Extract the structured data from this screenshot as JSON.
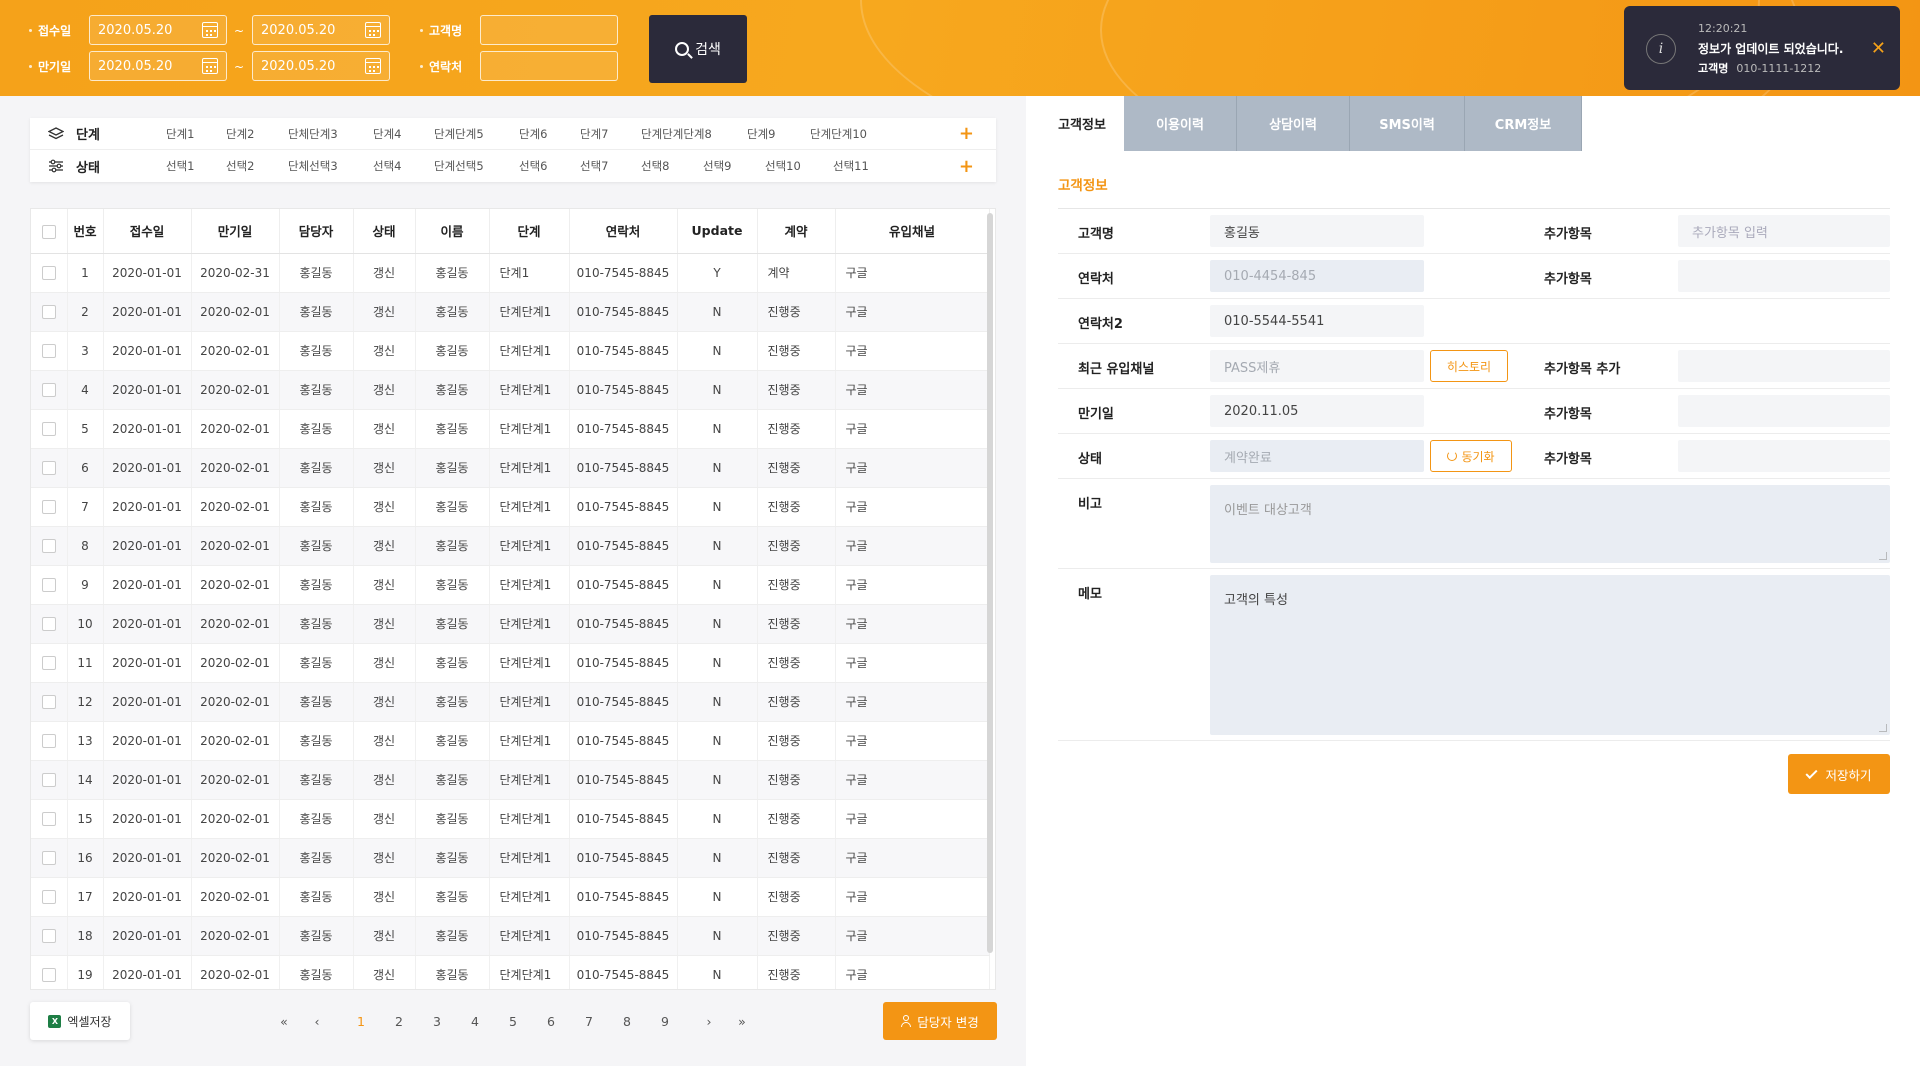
{
  "header": {
    "receipt_label": "접수일",
    "receipt_from": "2020.05.20",
    "receipt_to": "2020.05.20",
    "expiry_label": "만기일",
    "expiry_from": "2020.05.20",
    "expiry_to": "2020.05.20",
    "tilde": "~",
    "customer_label": "고객명",
    "contact_label": "연락처",
    "search_label": "검색"
  },
  "toast": {
    "icon": "i",
    "time": "12:20:21",
    "message": "정보가 업데이트 되었습니다.",
    "sub_label": "고객명",
    "sub_value": "010-1111-1212",
    "close": "✕"
  },
  "filter": {
    "stage_title": "단계",
    "stage_items": [
      "단계1",
      "단계2",
      "단체단계3",
      "단계4",
      "단계단계5",
      "단계6",
      "단계7",
      "단계단계단계8",
      "단계9",
      "단계단계10"
    ],
    "state_title": "상태",
    "state_items": [
      "선택1",
      "선택2",
      "단체선택3",
      "선택4",
      "단계선택5",
      "선택6",
      "선택7",
      "선택8",
      "선택9",
      "선택10",
      "선택11"
    ],
    "plus": "+"
  },
  "table": {
    "headers": [
      "번호",
      "접수일",
      "만기일",
      "담당자",
      "상태",
      "이름",
      "단계",
      "연락처",
      "Update",
      "계약",
      "유입채널"
    ],
    "rows": [
      [
        "1",
        "2020-01-01",
        "2020-02-31",
        "홍길동",
        "갱신",
        "홍길동",
        "단계1",
        "010-7545-8845",
        "Y",
        "계약",
        "구글"
      ],
      [
        "2",
        "2020-01-01",
        "2020-02-01",
        "홍길동",
        "갱신",
        "홍길동",
        "단계단계1",
        "010-7545-8845",
        "N",
        "진행중",
        "구글"
      ],
      [
        "3",
        "2020-01-01",
        "2020-02-01",
        "홍길동",
        "갱신",
        "홍길동",
        "단계단계1",
        "010-7545-8845",
        "N",
        "진행중",
        "구글"
      ],
      [
        "4",
        "2020-01-01",
        "2020-02-01",
        "홍길동",
        "갱신",
        "홍길동",
        "단계단계1",
        "010-7545-8845",
        "N",
        "진행중",
        "구글"
      ],
      [
        "5",
        "2020-01-01",
        "2020-02-01",
        "홍길동",
        "갱신",
        "홍길동",
        "단계단계1",
        "010-7545-8845",
        "N",
        "진행중",
        "구글"
      ],
      [
        "6",
        "2020-01-01",
        "2020-02-01",
        "홍길동",
        "갱신",
        "홍길동",
        "단계단계1",
        "010-7545-8845",
        "N",
        "진행중",
        "구글"
      ],
      [
        "7",
        "2020-01-01",
        "2020-02-01",
        "홍길동",
        "갱신",
        "홍길동",
        "단계단계1",
        "010-7545-8845",
        "N",
        "진행중",
        "구글"
      ],
      [
        "8",
        "2020-01-01",
        "2020-02-01",
        "홍길동",
        "갱신",
        "홍길동",
        "단계단계1",
        "010-7545-8845",
        "N",
        "진행중",
        "구글"
      ],
      [
        "9",
        "2020-01-01",
        "2020-02-01",
        "홍길동",
        "갱신",
        "홍길동",
        "단계단계1",
        "010-7545-8845",
        "N",
        "진행중",
        "구글"
      ],
      [
        "10",
        "2020-01-01",
        "2020-02-01",
        "홍길동",
        "갱신",
        "홍길동",
        "단계단계1",
        "010-7545-8845",
        "N",
        "진행중",
        "구글"
      ],
      [
        "11",
        "2020-01-01",
        "2020-02-01",
        "홍길동",
        "갱신",
        "홍길동",
        "단계단계1",
        "010-7545-8845",
        "N",
        "진행중",
        "구글"
      ],
      [
        "12",
        "2020-01-01",
        "2020-02-01",
        "홍길동",
        "갱신",
        "홍길동",
        "단계단계1",
        "010-7545-8845",
        "N",
        "진행중",
        "구글"
      ],
      [
        "13",
        "2020-01-01",
        "2020-02-01",
        "홍길동",
        "갱신",
        "홍길동",
        "단계단계1",
        "010-7545-8845",
        "N",
        "진행중",
        "구글"
      ],
      [
        "14",
        "2020-01-01",
        "2020-02-01",
        "홍길동",
        "갱신",
        "홍길동",
        "단계단계1",
        "010-7545-8845",
        "N",
        "진행중",
        "구글"
      ],
      [
        "15",
        "2020-01-01",
        "2020-02-01",
        "홍길동",
        "갱신",
        "홍길동",
        "단계단계1",
        "010-7545-8845",
        "N",
        "진행중",
        "구글"
      ],
      [
        "16",
        "2020-01-01",
        "2020-02-01",
        "홍길동",
        "갱신",
        "홍길동",
        "단계단계1",
        "010-7545-8845",
        "N",
        "진행중",
        "구글"
      ],
      [
        "17",
        "2020-01-01",
        "2020-02-01",
        "홍길동",
        "갱신",
        "홍길동",
        "단계단계1",
        "010-7545-8845",
        "N",
        "진행중",
        "구글"
      ],
      [
        "18",
        "2020-01-01",
        "2020-02-01",
        "홍길동",
        "갱신",
        "홍길동",
        "단계단계1",
        "010-7545-8845",
        "N",
        "진행중",
        "구글"
      ],
      [
        "19",
        "2020-01-01",
        "2020-02-01",
        "홍길동",
        "갱신",
        "홍길동",
        "단계단계1",
        "010-7545-8845",
        "N",
        "진행중",
        "구글"
      ]
    ]
  },
  "footer": {
    "excel_label": "엑셀저장",
    "excel_icon": "X",
    "first": "«",
    "prev": "‹",
    "pages": [
      "1",
      "2",
      "3",
      "4",
      "5",
      "6",
      "7",
      "8",
      "9"
    ],
    "active_page": "1",
    "next": "›",
    "last": "»",
    "assign_label": "담당자 변경"
  },
  "tabs": [
    "고객정보",
    "이용이력",
    "상담이력",
    "SMS이력",
    "CRM정보"
  ],
  "detail": {
    "section_title": "고객정보",
    "name_label": "고객명",
    "name_value": "홍길동",
    "extra1_label": "추가항목",
    "extra1_placeholder": "추가항목 입력",
    "phone_label": "연락처",
    "phone_value": "010-4454-845",
    "extra2_label": "추가항목",
    "phone2_label": "연락처2",
    "phone2_value": "010-5544-5541",
    "channel_label": "최근 유입채널",
    "channel_value": "PASS제휴",
    "history_label": "히스토리",
    "extra_add_label": "추가항목 추가",
    "expiry_label": "만기일",
    "expiry_value": "2020.11.05",
    "extra3_label": "추가항목",
    "status_label": "상태",
    "status_value": "계약완료",
    "sync_label": "동기화",
    "extra4_label": "추가항목",
    "note_label": "비고",
    "note_placeholder": "이벤트 대상고객",
    "memo_label": "메모",
    "memo_value": "고객의 특성",
    "save_label": "저장하기"
  },
  "colors": {
    "accent": "#f39514",
    "dark": "#2b2a3a",
    "tab_inactive": "#aeb9c6"
  }
}
